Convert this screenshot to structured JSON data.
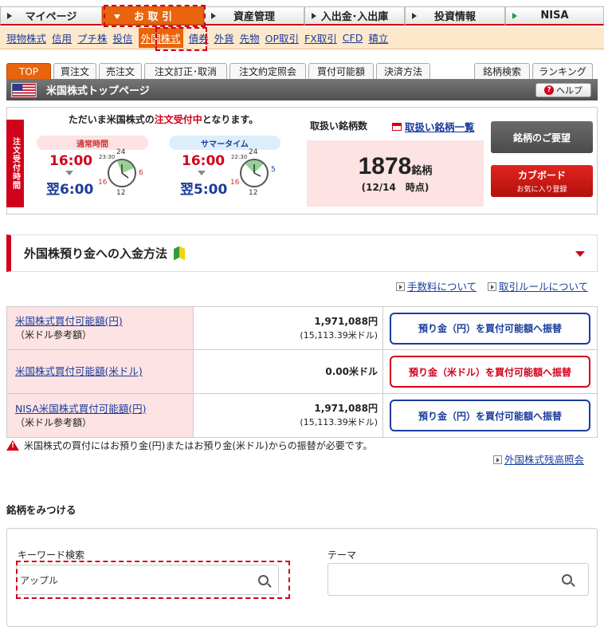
{
  "topnav": [
    {
      "label": "マイページ",
      "active": false
    },
    {
      "label": "お 取 引",
      "active": true
    },
    {
      "label": "資産管理",
      "active": false
    },
    {
      "label": "入出金･入出庫",
      "active": false
    },
    {
      "label": "投資情報",
      "active": false
    },
    {
      "label": "NISA",
      "active": false
    }
  ],
  "subnav": [
    "現物株式",
    "信用",
    "プチ株",
    "投信",
    "外国株式",
    "債券",
    "外貨",
    "先物",
    "OP取引",
    "FX取引",
    "CFD",
    "積立"
  ],
  "tabs_left": [
    "TOP",
    "買注文",
    "売注文",
    "注文訂正･取消",
    "注文約定照会",
    "買付可能額",
    "決済方法"
  ],
  "tabs_right": [
    "銘柄検索",
    "ランキング"
  ],
  "page_title": "米国株式トップページ",
  "help_label": "ヘルプ",
  "info": {
    "strip": "注文受付時間",
    "headline_pre": "ただいま米国株式の",
    "headline_hl": "注文受付中",
    "headline_post": "となります。",
    "normal": {
      "label": "通常時間",
      "start": "16:00",
      "end": "翌6:00",
      "clock_top": "24",
      "clock_right": "6",
      "clock_left": "16",
      "clock_bottom": "12",
      "clock_tl": "23:30"
    },
    "summer": {
      "label": "サマータイム",
      "start": "16:00",
      "end": "翌5:00",
      "clock_top": "24",
      "clock_right": "5",
      "clock_left": "16",
      "clock_bottom": "12",
      "clock_tl": "22:30"
    },
    "count_label": "取扱い銘柄数",
    "list_link": "取扱い銘柄一覧",
    "count": "1878",
    "count_unit": "銘柄",
    "count_date": "(12/14　時点)",
    "request_btn": "銘柄のご要望",
    "cupboard_btn": "カブボード",
    "cupboard_sub": "お気に入り登録"
  },
  "deposit_accordion": "外国株預り金への入金方法",
  "links": {
    "fee": "手数料について",
    "rules": "取引ルールについて",
    "balance": "外国株式残高照会"
  },
  "funds": [
    {
      "label": "米国株式買付可能額(円)",
      "sub": "（米ドル参考額）",
      "value": "1,971,088円",
      "ref": "(15,113.39米ドル)",
      "button": "預り金（円）を買付可能額へ振替",
      "btn_color": "blue"
    },
    {
      "label": "米国株式買付可能額(米ドル)",
      "sub": "",
      "value": "0.00米ドル",
      "ref": "",
      "button": "預り金（米ドル）を買付可能額へ振替",
      "btn_color": "red"
    },
    {
      "label": "NISA米国株式買付可能額(円)",
      "sub": "（米ドル参考額）",
      "value": "1,971,088円",
      "ref": "(15,113.39米ドル)",
      "button": "預り金（円）を買付可能額へ振替",
      "btn_color": "blue"
    }
  ],
  "warning": "米国株式の買付にはお預り金(円)またはお預り金(米ドル)からの振替が必要です。",
  "find": {
    "title": "銘柄をみつける",
    "keyword_label": "キーワード検索",
    "keyword_value": "アップル",
    "theme_label": "テーマ",
    "theme_value": ""
  },
  "colors": {
    "accent": "#e8640d",
    "brand_red": "#d0021b",
    "link": "#1a3c9c"
  }
}
